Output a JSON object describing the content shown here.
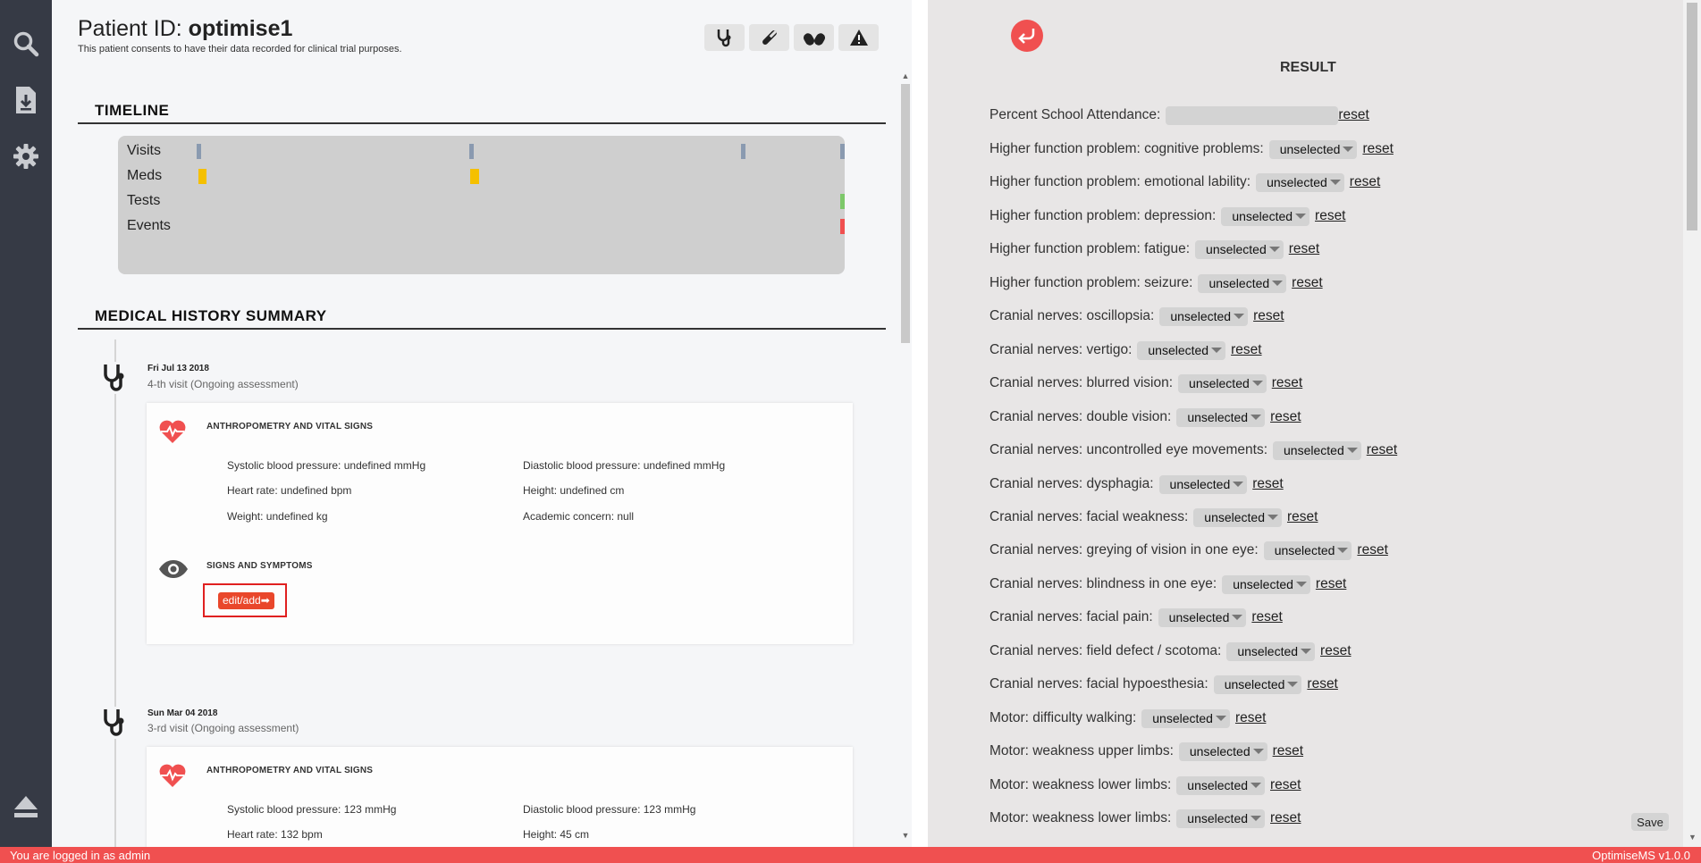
{
  "nav": {
    "icons": [
      "search-icon",
      "download-icon",
      "gear-icon",
      "eject-icon"
    ]
  },
  "patient": {
    "title_prefix": "Patient ID: ",
    "id": "optimise1",
    "consent": "This patient consents to have their data recorded for clinical trial purposes."
  },
  "toolbar": {
    "icons": [
      "stethoscope-icon",
      "test-tube-icon",
      "pills-icon",
      "warning-icon"
    ]
  },
  "timeline": {
    "title": "TIMELINE",
    "rows": [
      "Visits",
      "Meds",
      "Tests",
      "Events"
    ]
  },
  "history": {
    "title": "MEDICAL HISTORY SUMMARY",
    "visits": [
      {
        "date": "Fri Jul 13 2018",
        "sub": "4-th visit (Ongoing assessment)",
        "vitals_heading": "ANTHROPOMETRY AND VITAL SIGNS",
        "vitals": [
          "Systolic blood pressure: undefined mmHg",
          "Diastolic blood pressure: undefined mmHg",
          "Heart rate: undefined bpm",
          "Height: undefined cm",
          "Weight: undefined kg",
          "Academic concern: null"
        ],
        "signs_heading": "SIGNS AND SYMPTOMS",
        "edit_label": "edit/add➡"
      },
      {
        "date": "Sun Mar 04 2018",
        "sub": "3-rd visit (Ongoing assessment)",
        "vitals_heading": "ANTHROPOMETRY AND VITAL SIGNS",
        "vitals": [
          "Systolic blood pressure: 123 mmHg",
          "Diastolic blood pressure: 123 mmHg",
          "Heart rate: 132 bpm",
          "Height: 45 cm"
        ]
      }
    ]
  },
  "result": {
    "title": "RESULT",
    "reset_label": "reset",
    "percent_label": "Percent School Attendance:",
    "percent_value": "",
    "fields": [
      {
        "label": "Higher function problem: cognitive problems:",
        "value": "unselected"
      },
      {
        "label": "Higher function problem: emotional lability:",
        "value": "unselected"
      },
      {
        "label": "Higher function problem: depression:",
        "value": "unselected"
      },
      {
        "label": "Higher function problem: fatigue:",
        "value": "unselected"
      },
      {
        "label": "Higher function problem: seizure:",
        "value": "unselected"
      },
      {
        "label": "Cranial nerves: oscillopsia:",
        "value": "unselected"
      },
      {
        "label": "Cranial nerves: vertigo:",
        "value": "unselected"
      },
      {
        "label": "Cranial nerves: blurred vision:",
        "value": "unselected"
      },
      {
        "label": "Cranial nerves: double vision:",
        "value": "unselected"
      },
      {
        "label": "Cranial nerves: uncontrolled eye movements:",
        "value": "unselected"
      },
      {
        "label": "Cranial nerves: dysphagia:",
        "value": "unselected"
      },
      {
        "label": "Cranial nerves: facial weakness:",
        "value": "unselected"
      },
      {
        "label": "Cranial nerves: greying of vision in one eye:",
        "value": "unselected"
      },
      {
        "label": "Cranial nerves: blindness in one eye:",
        "value": "unselected"
      },
      {
        "label": "Cranial nerves: facial pain:",
        "value": "unselected"
      },
      {
        "label": "Cranial nerves: field defect / scotoma:",
        "value": "unselected"
      },
      {
        "label": "Cranial nerves: facial hypoesthesia:",
        "value": "unselected"
      },
      {
        "label": "Motor: difficulty walking:",
        "value": "unselected"
      },
      {
        "label": "Motor: weakness upper limbs:",
        "value": "unselected"
      },
      {
        "label": "Motor: weakness lower limbs:",
        "value": "unselected"
      },
      {
        "label": "Motor: weakness lower limbs:",
        "value": "unselected"
      }
    ],
    "save_label": "Save"
  },
  "footer": {
    "left": "You are logged in as admin",
    "right": "OptimiseMS v1.0.0"
  },
  "colors": {
    "accent_red": "#f05050",
    "edit_orange": "#e9472b",
    "nav_bg": "#363a45",
    "visit_marker": "#8a9ab0",
    "med_marker": "#f5c000",
    "test_marker": "#7dc86a",
    "event_marker": "#f05050"
  }
}
